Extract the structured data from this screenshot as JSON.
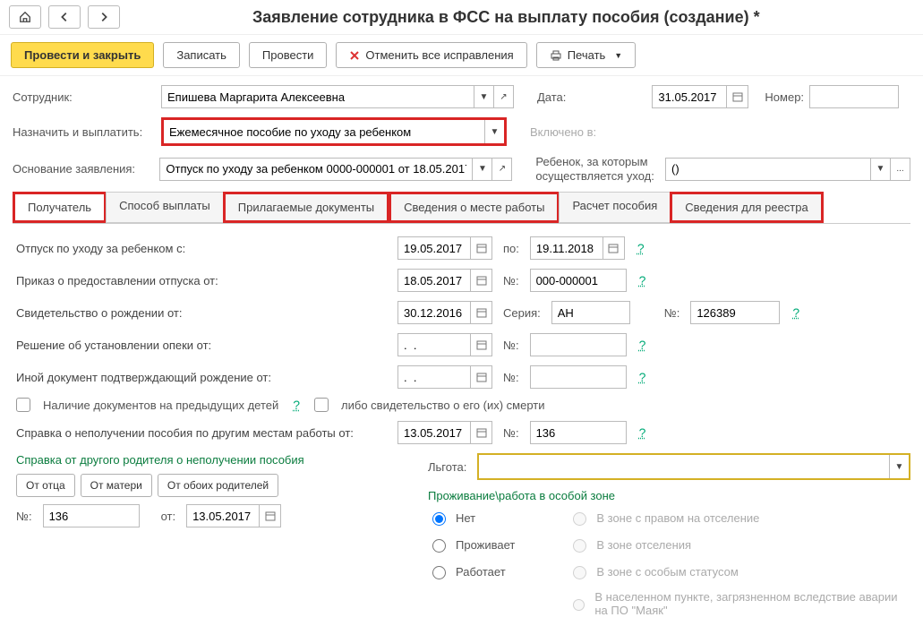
{
  "title": "Заявление сотрудника в ФСС на выплату пособия (создание) *",
  "cmd": {
    "post_close": "Провести и закрыть",
    "save": "Записать",
    "post": "Провести",
    "cancel_fix": "Отменить все исправления",
    "print": "Печать"
  },
  "labels": {
    "employee": "Сотрудник:",
    "date": "Дата:",
    "number": "Номер:",
    "assign": "Назначить и выплатить:",
    "included": "Включено в:",
    "basis": "Основание заявления:",
    "child": "Ребенок, за которым осуществляется уход:",
    "leave_from": "Отпуск по уходу за ребенком с:",
    "to": "по:",
    "order_from": "Приказ о предоставлении отпуска от:",
    "no": "№:",
    "seria": "Серия:",
    "birth_cert": "Свидетельство о рождении от:",
    "custody": "Решение об установлении опеки от:",
    "other_doc": "Иной документ подтверждающий рождение от:",
    "prev_docs": "Наличие документов на предыдущих детей",
    "death_cert": "либо свидетельство о его (их) смерти",
    "ref_other": "Справка о неполучении пособия по другим местам работы от:",
    "ref_parent": "Справка от другого родителя о неполучении пособия",
    "benefit": "Льгота:",
    "zone": "Проживание\\работа в особой зоне",
    "from": "от:"
  },
  "fields": {
    "employee": "Епишева Маргарита Алексеевна",
    "date": "31.05.2017",
    "number": "",
    "assign": "Ежемесячное пособие по уходу за ребенком",
    "included": "",
    "basis": "Отпуск по уходу за ребенком 0000-000001 от 18.05.2017",
    "child": "()",
    "leave_from": "19.05.2017",
    "leave_to": "19.11.2018",
    "order_from": "18.05.2017",
    "order_no": "000-000001",
    "birth_from": "30.12.2016",
    "birth_seria": "АН",
    "birth_no": "126389",
    "custody_from": ".  .",
    "custody_no": "",
    "other_from": ".  .",
    "other_no": "",
    "ref_other_from": "13.05.2017",
    "ref_other_no": "136",
    "ref_parent_no": "136",
    "ref_parent_from": "13.05.2017",
    "benefit": ""
  },
  "tabs": {
    "recipient": "Получатель",
    "payment": "Способ выплаты",
    "docs": "Прилагаемые документы",
    "work": "Сведения о месте работы",
    "calc": "Расчет пособия",
    "registry": "Сведения для реестра"
  },
  "parent": {
    "father": "От отца",
    "mother": "От матери",
    "both": "От обоих родителей"
  },
  "zone": {
    "no": "Нет",
    "lives": "Проживает",
    "works": "Работает",
    "right": "В зоне с правом на отселение",
    "settle": "В зоне отселения",
    "status": "В зоне с особым статусом",
    "mayak": "В населенном пункте, загрязненном вследствие аварии на ПО \"Маяк\""
  }
}
